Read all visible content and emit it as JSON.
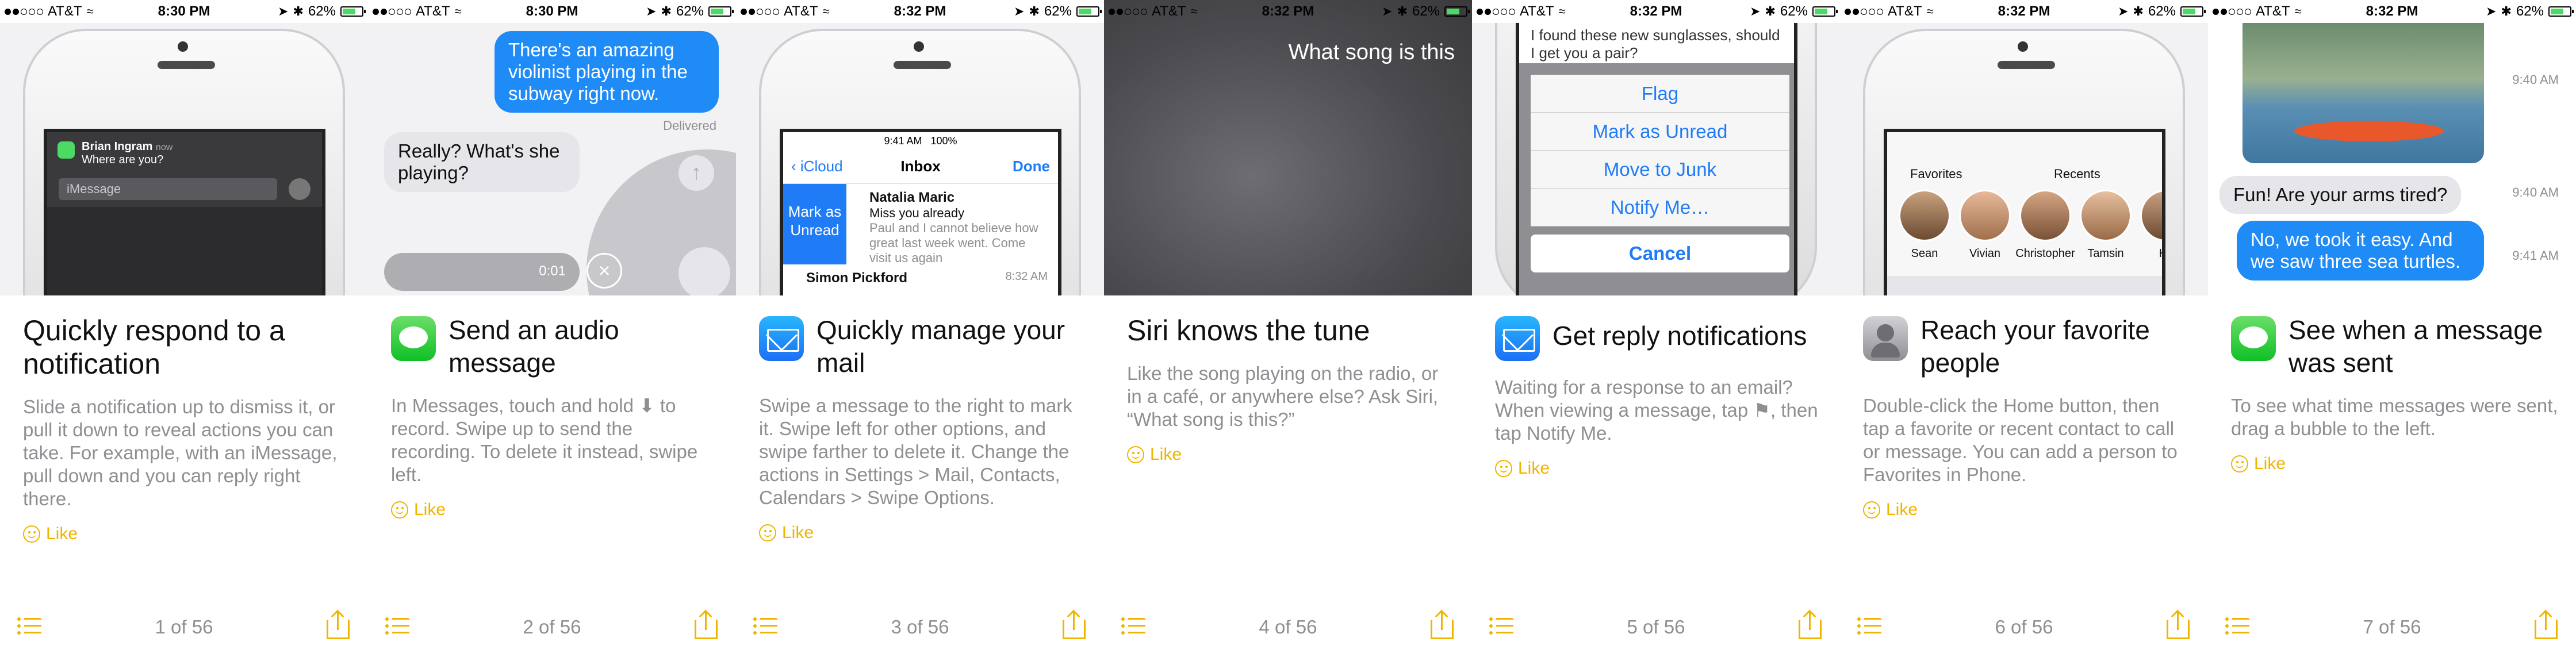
{
  "status": {
    "carrier": "AT&T",
    "battery": "62%",
    "times": [
      "8:30 PM",
      "8:30 PM",
      "8:32 PM",
      "8:32 PM",
      "8:32 PM",
      "8:32 PM",
      "8:32 PM"
    ]
  },
  "panels": [
    {
      "title": "Quickly respond to a notification",
      "desc": "Slide a notification up to dismiss it, or pull it down to reveal actions you can take. For example, with an iMessage, pull down and you can reply right there.",
      "like": "Like",
      "pager": "1 of 56",
      "notification": {
        "sender": "Brian Ingram",
        "time": "now",
        "body": "Where are you?",
        "field": "iMessage"
      }
    },
    {
      "title": "Send an audio message",
      "desc": "In Messages, touch and hold ⬇ to record. Swipe up to send the recording. To delete it instead, swipe left.",
      "like": "Like",
      "pager": "2 of 56",
      "bubble_out": "There's an amazing violinist playing in the subway right now.",
      "delivered": "Delivered",
      "bubble_in": "Really? What's she playing?",
      "audio_time": "0:01"
    },
    {
      "title": "Quickly manage your mail",
      "desc": "Swipe a message to the right to mark it. Swipe left for other options, and swipe farther to delete it. Change the actions in Settings > Mail, Contacts, Calendars > Swipe Options.",
      "like": "Like",
      "pager": "3 of 56",
      "inbox": {
        "time": "9:41 AM",
        "battery": "100%",
        "back": "iCloud",
        "title": "Inbox",
        "done": "Done",
        "action": "Mark as Unread",
        "from": "Natalia Maric",
        "subject": "Miss you already",
        "preview": "Paul and I cannot believe how great last week went. Come visit us again",
        "from2": "Simon Pickford",
        "time2": "8:32 AM"
      }
    },
    {
      "title": "Siri knows the tune",
      "desc": "Like the song playing on the radio, or in a café, or anywhere else? Ask Siri, “What song is this?”",
      "like": "Like",
      "pager": "4 of 56",
      "siri_text": "What song is this"
    },
    {
      "title": "Get reply notifications",
      "desc": "Waiting for a response to an email? When viewing a message, tap ⚑, then tap Notify Me.",
      "like": "Like",
      "pager": "5 of 56",
      "email_text": "I found these new sunglasses, should I get you a pair?",
      "sheet": [
        "Flag",
        "Mark as Unread",
        "Move to Junk",
        "Notify Me…"
      ],
      "cancel": "Cancel"
    },
    {
      "title": "Reach your favorite people",
      "desc": "Double-click the Home button, then tap a favorite or recent contact to call or message. You can add a person to Favorites in Phone.",
      "like": "Like",
      "pager": "6 of 56",
      "favorites_label": "Favorites",
      "recents_label": "Recents",
      "people": [
        "Sean",
        "Vivian",
        "Christopher",
        "Tamsin",
        "Ka"
      ]
    },
    {
      "title": "See when a message was sent",
      "desc": "To see what time messages were sent, drag a bubble to the left.",
      "like": "Like",
      "pager": "7 of 56",
      "bubble_in": "Fun! Are your arms tired?",
      "bubble_out": "No, we took it easy. And we saw three sea turtles.",
      "times": [
        "9:40 AM",
        "9:40 AM",
        "9:41 AM"
      ]
    }
  ]
}
